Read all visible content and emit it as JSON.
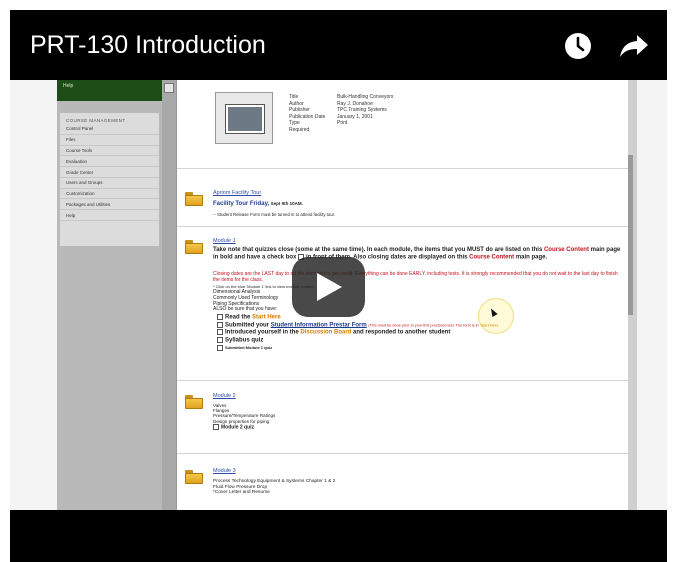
{
  "video": {
    "title": "PRT-130 Introduction",
    "icons": [
      "watch-later-icon",
      "share-icon",
      "play-icon"
    ]
  },
  "lms": {
    "sidebar_top": "Help",
    "menu_heading": "COURSE MANAGEMENT",
    "menu_items": [
      "Control Panel",
      "Files",
      "Course Tools",
      "Evaluation",
      "Grade Center",
      "Users and Groups",
      "Customization",
      "Packages and Utilities",
      "Help"
    ],
    "book": {
      "rows": [
        {
          "k": "Title",
          "v": "Bulk-Handling Conveyors"
        },
        {
          "k": "Author",
          "v": "Ray J. Donahoe"
        },
        {
          "k": "Publisher",
          "v": "TPC Training Systems"
        },
        {
          "k": "Publication Date",
          "v": "January 1, 2001"
        },
        {
          "k": "Type",
          "v": "Print"
        },
        {
          "k": "Required",
          "v": ""
        }
      ]
    },
    "tour": {
      "title": "Apriom Facility Tour",
      "line1": "Facility Tour Friday,",
      "line1b": "Sept 9th 10AM.",
      "line2": "-- Student Release Form must be turned in to attend facility tour."
    },
    "module1": {
      "title": "Module 1",
      "para1": "Take note that quizzes close (some at the same time). In each module, the items that you MUST do are listed on this",
      "cc1": "Course Content",
      "para1b": "main page in bold and have a check box",
      "para1c": "in front of them. Also closing dates are displayed on this",
      "cc2": "Course Content",
      "para1d": "main page.",
      "red1": "Closing dates are the LAST day to do the item and to get credit. Everything can be done EARLY, including tests. It is strongly",
      "red2": "recommended that you do not wait to the last day to finish the items for the class.",
      "click": "* Click on the blue 'Module 1' link to view module content.",
      "items": [
        "Dimensional Analysis",
        "Commonly Used Terminology",
        "Piping Specifications",
        "ALSO be sure that you have:"
      ],
      "task1": "Read the",
      "task1b": "Start Here",
      "task2": "Submitted your",
      "task2b": "Student Information Prestar Form",
      "task2c": "(This must be done prior to your first proctored test. The form is in",
      "task2d": "Start Here",
      "task3": "Introduced yourself in the",
      "task3b": "Discussion Board",
      "task3c": "and responded to another student",
      "task4": "Syllabus quiz",
      "task5": "Submitted Module 1 quiz"
    },
    "module2": {
      "title": "Module 2",
      "items": [
        "Valves",
        "Flanges",
        "Pressure/Temperature Ratings",
        "Design properties for piping"
      ],
      "quiz": "Module 2 quiz"
    },
    "module3": {
      "title": "Module 3",
      "items": [
        "Process Technology Equipment & Systems Chapter 1 & 2",
        "Fluid Flow Pressure Drop",
        "*Cover Letter and Resume"
      ]
    }
  }
}
